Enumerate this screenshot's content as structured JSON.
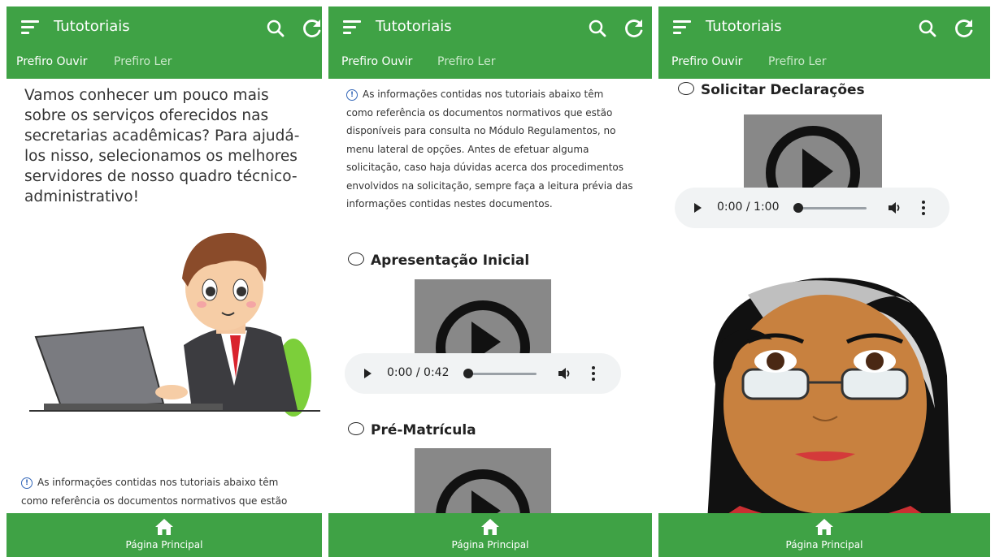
{
  "app": {
    "title": "Tutotoriais",
    "search_icon": "search-icon",
    "refresh_icon": "refresh-icon",
    "menu_icon": "menu-icon",
    "accent": "#3fa245"
  },
  "tabs": [
    {
      "label": "Prefiro Ouvir",
      "active": true
    },
    {
      "label": "Prefiro Ler",
      "active": false
    }
  ],
  "bottom_nav": {
    "label": "Página Principal",
    "icon": "home-icon"
  },
  "screen1": {
    "intro_lines": [
      "Vamos conhecer um pouco mais",
      "sobre os serviços oferecidos nas",
      "secretarias acadêmicas? Para ajudá-",
      "los nisso, selecionamos os melhores",
      "servidores de nosso quadro técnico-",
      "administrativo!"
    ],
    "info_lines": [
      "As informações contidas nos tutoriais abaixo têm",
      "como referência os documentos normativos que estão"
    ]
  },
  "screen2": {
    "info_lines": [
      "As informações contidas nos tutoriais abaixo têm",
      "como referência os documentos normativos que estão",
      "disponíveis para consulta no Módulo Regulamentos, no",
      "menu lateral de opções. Antes de efetuar alguma",
      "solicitação, caso haja dúvidas acerca dos procedimentos",
      "envolvidos na solicitação, sempre faça a leitura prévia das",
      "informações contidas nestes documentos."
    ],
    "sections": [
      {
        "title": "Apresentação Inicial",
        "time": "0:00 / 0:42"
      },
      {
        "title": "Pré-Matrícula"
      }
    ]
  },
  "screen3": {
    "sections": [
      {
        "title": "Solicitar Declarações",
        "time": "0:00 / 1:00"
      }
    ]
  }
}
